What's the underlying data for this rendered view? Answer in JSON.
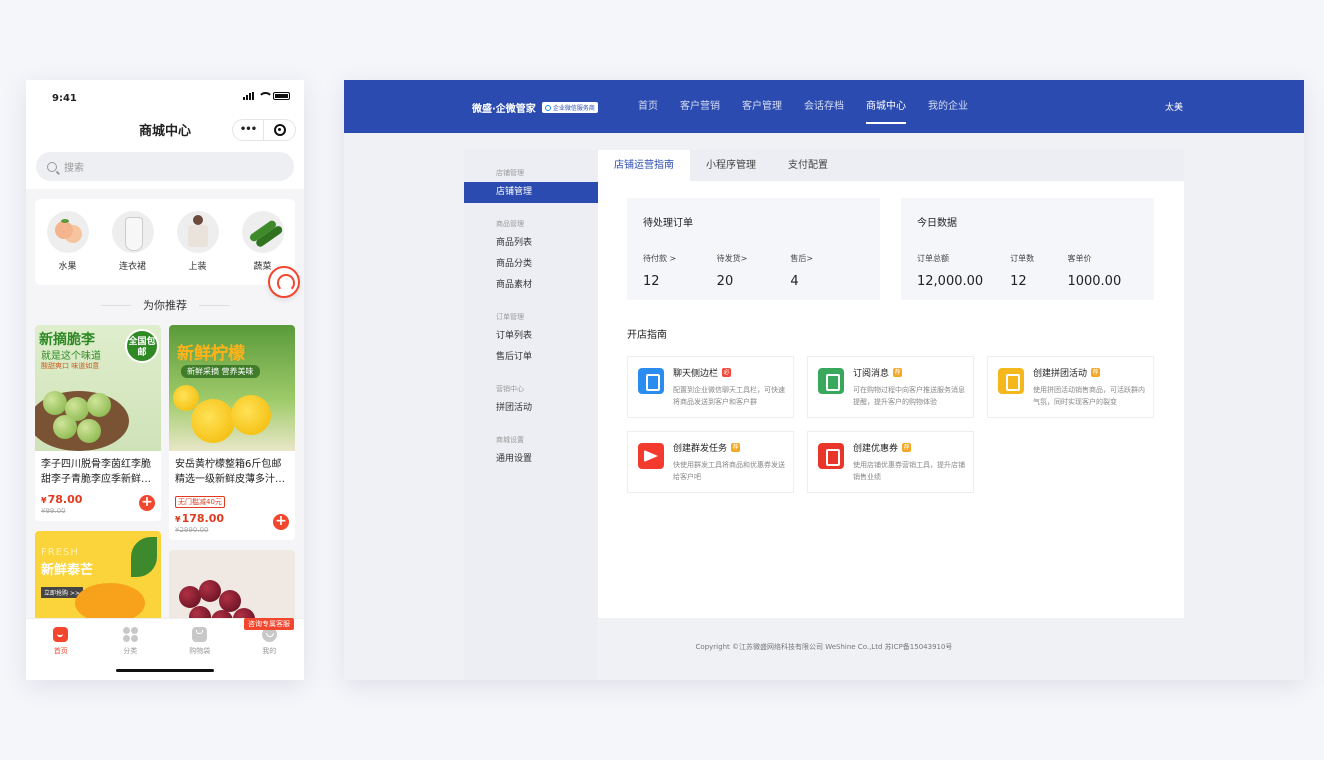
{
  "phone": {
    "status_time": "9:41",
    "nav_title": "商城中心",
    "capsule_more": "•••",
    "search_placeholder": "搜索",
    "categories": [
      {
        "label": "水果",
        "icon": "peach-icon"
      },
      {
        "label": "连衣裙",
        "icon": "dress-icon"
      },
      {
        "label": "上装",
        "icon": "top-clothes-icon"
      },
      {
        "label": "蔬菜",
        "icon": "cucumber-icon"
      }
    ],
    "recommend_title": "为你推荐",
    "products": [
      {
        "banner1": "新摘脆李",
        "banner2": "就是这个味道",
        "banner3": "酸甜爽口 味道如意",
        "seal": "全国包邮",
        "name": "李子四川脱骨李茵红李脆甜李子青脆李应季新鲜…",
        "price_symbol": "¥",
        "price": "78.00",
        "original_price": "¥99.00"
      },
      {
        "banner1": "新鲜柠檬",
        "banner2": "新鲜采摘 营养美味",
        "name": "安岳黄柠檬整箱6斤包邮精选一级新鲜皮薄多汁…",
        "promo": "无门槛减40元",
        "price_symbol": "¥",
        "price": "178.00",
        "original_price": "¥2990.00"
      },
      {
        "banner1": "FRESH",
        "banner2": "新鲜泰芒",
        "banner3": "立即抢购 >>"
      },
      {}
    ],
    "kefu_tag": "咨询专属客服",
    "tabs": [
      {
        "label": "首页",
        "active": true
      },
      {
        "label": "分类",
        "active": false
      },
      {
        "label": "购物袋",
        "active": false
      },
      {
        "label": "我的",
        "active": false
      }
    ],
    "accent_color": "#f2462e"
  },
  "admin": {
    "brand": "微盛·企微管家",
    "brand_badge": "企业微信服务商",
    "nav": [
      {
        "label": "首页",
        "active": false
      },
      {
        "label": "客户营销",
        "active": false
      },
      {
        "label": "客户管理",
        "active": false
      },
      {
        "label": "会话存档",
        "active": false
      },
      {
        "label": "商城中心",
        "active": true
      },
      {
        "label": "我的企业",
        "active": false
      }
    ],
    "user": "太美",
    "sidebar": [
      {
        "group": "店铺管理",
        "items": [
          {
            "label": "店铺管理",
            "active": true
          }
        ]
      },
      {
        "group": "商品管理",
        "items": [
          {
            "label": "商品列表"
          },
          {
            "label": "商品分类"
          },
          {
            "label": "商品素材"
          }
        ]
      },
      {
        "group": "订单管理",
        "items": [
          {
            "label": "订单列表"
          },
          {
            "label": "售后订单"
          }
        ]
      },
      {
        "group": "营销中心",
        "items": [
          {
            "label": "拼团活动"
          }
        ]
      },
      {
        "group": "商城设置",
        "items": [
          {
            "label": "通用设置"
          }
        ]
      }
    ],
    "tabs": [
      {
        "label": "店铺运营指南",
        "active": true
      },
      {
        "label": "小程序管理",
        "active": false
      },
      {
        "label": "支付配置",
        "active": false
      }
    ],
    "pending_orders": {
      "title": "待处理订单",
      "stats": [
        {
          "label": "待付款 >",
          "value": "12"
        },
        {
          "label": "待发货>",
          "value": "20"
        },
        {
          "label": "售后>",
          "value": "4"
        }
      ]
    },
    "today_data": {
      "title": "今日数据",
      "stats": [
        {
          "label": "订单总额",
          "value": "12,000.00"
        },
        {
          "label": "订单数",
          "value": "12"
        },
        {
          "label": "客单价",
          "value": "1000.00"
        }
      ]
    },
    "guide_title": "开店指南",
    "guides": [
      {
        "title": "聊天侧边栏",
        "tag": "必",
        "tag_color": "red",
        "desc": "配置到企业微信聊天工具栏，可快速将商品发送到客户和客户群",
        "icon": "sidebar-icon",
        "icon_color": "#2b8cf0"
      },
      {
        "title": "订阅消息",
        "tag": "荐",
        "tag_color": "orange",
        "desc": "可在购物过程中向客户推送服务消息提醒，提升客户的购物体验",
        "icon": "message-icon",
        "icon_color": "#3aa85c"
      },
      {
        "title": "创建拼团活动",
        "tag": "荐",
        "tag_color": "orange",
        "desc": "使用拼团活动销售商品，可活跃群内气氛，同时实现客户的裂变",
        "icon": "group-buy-icon",
        "icon_color": "#f5b81c"
      },
      {
        "title": "创建群发任务",
        "tag": "荐",
        "tag_color": "orange",
        "desc": "快使用群发工具将商品和优惠券发送给客户吧",
        "icon": "send-icon",
        "icon_color": "#f23a2e"
      },
      {
        "title": "创建优惠券",
        "tag": "荐",
        "tag_color": "orange",
        "desc": "使用店铺优惠券营销工具，提升店铺销售业绩",
        "icon": "coupon-icon",
        "icon_color": "#e9362a"
      }
    ],
    "footer": "Copyright ©江苏微盛网络科技有限公司 WeShine Co.,Ltd 苏ICP备15043910号",
    "brand_color": "#2b4bb0"
  }
}
